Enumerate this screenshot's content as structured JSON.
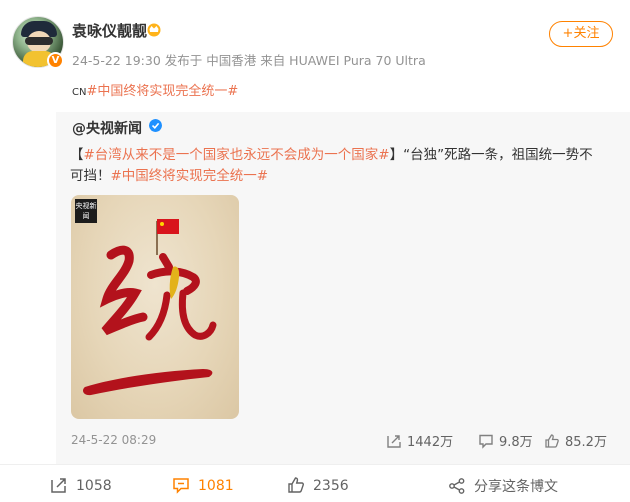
{
  "user": {
    "name": "袁咏仪靓靓",
    "meta": "24-5-22 19:30  发布于 中国香港  来自 HUAWEI Pura 70 Ultra",
    "follow_label": "+关注"
  },
  "post": {
    "prefix": "CN",
    "hashtag": "#中国终将实现完全统一#"
  },
  "repost": {
    "author": "@央视新闻",
    "bracket_open": "【",
    "hashtag1": "#台湾从来不是一个国家也永远不会成为一个国家#",
    "line1_rest": "】“台独”死路一条，祖国统一势不",
    "line2_start": "可挡！",
    "hashtag2": "#中国终将实现完全统一#",
    "image_logo": "央视新闻",
    "time": "24-5-22 08:29",
    "shares": "1442万",
    "comments": "9.8万",
    "likes": "85.2万"
  },
  "actions": {
    "share_count": "1058",
    "comment_count": "1081",
    "like_count": "2356",
    "share_weibo": "分享这条博文"
  },
  "colors": {
    "accent": "#ff8200",
    "hashtag": "#eb7350",
    "calligraphy_red": "#b3121c"
  }
}
